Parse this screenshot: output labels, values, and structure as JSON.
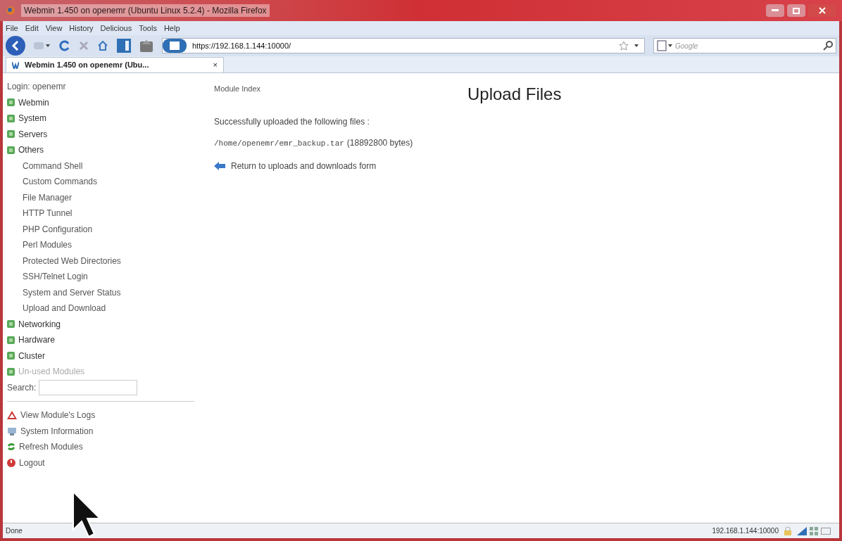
{
  "window": {
    "title": "Webmin 1.450 on openemr (Ubuntu Linux 5.2.4) - Mozilla Firefox"
  },
  "menu_bar": [
    "File",
    "Edit",
    "View",
    "History",
    "Delicious",
    "Tools",
    "Help"
  ],
  "address_bar": {
    "url": "https://192.168.1.144:10000/"
  },
  "search_bar": {
    "placeholder": "Google"
  },
  "tabs": [
    {
      "label": "Webmin 1.450 on openemr (Ubu...",
      "close": "×",
      "selected": true
    }
  ],
  "sidebar": {
    "login": "Login: openemr",
    "categories": [
      {
        "label": "Webmin",
        "disabled": false
      },
      {
        "label": "System",
        "disabled": false
      },
      {
        "label": "Servers",
        "disabled": false
      },
      {
        "label": "Others",
        "disabled": false,
        "children": [
          {
            "label": "Command Shell"
          },
          {
            "label": "Custom Commands"
          },
          {
            "label": "File Manager"
          },
          {
            "label": "HTTP Tunnel"
          },
          {
            "label": "PHP Configuration"
          },
          {
            "label": "Perl Modules"
          },
          {
            "label": "Protected Web Directories"
          },
          {
            "label": "SSH/Telnet Login"
          },
          {
            "label": "System and Server Status"
          },
          {
            "label": "Upload and Download"
          }
        ]
      },
      {
        "label": "Networking",
        "disabled": false
      },
      {
        "label": "Hardware",
        "disabled": false
      },
      {
        "label": "Cluster",
        "disabled": false
      },
      {
        "label": "Un-used Modules",
        "disabled": true
      }
    ],
    "search_label": "Search:",
    "links": [
      {
        "kind": "warning",
        "label": "View Module's Logs"
      },
      {
        "kind": "info",
        "label": "System Information"
      },
      {
        "kind": "refresh",
        "label": "Refresh Modules"
      },
      {
        "kind": "power",
        "label": "Logout"
      }
    ]
  },
  "main": {
    "module_index": "Module Index",
    "heading": "Upload Files",
    "message": "Successfully uploaded the following files :",
    "file_path": "/home/openemr/emr_backup.tar",
    "file_size": "(18892800 bytes)",
    "return_link": "Return to uploads and downloads form"
  },
  "status_bar": {
    "text": "Done",
    "address": "192.168.1.144:10000"
  }
}
